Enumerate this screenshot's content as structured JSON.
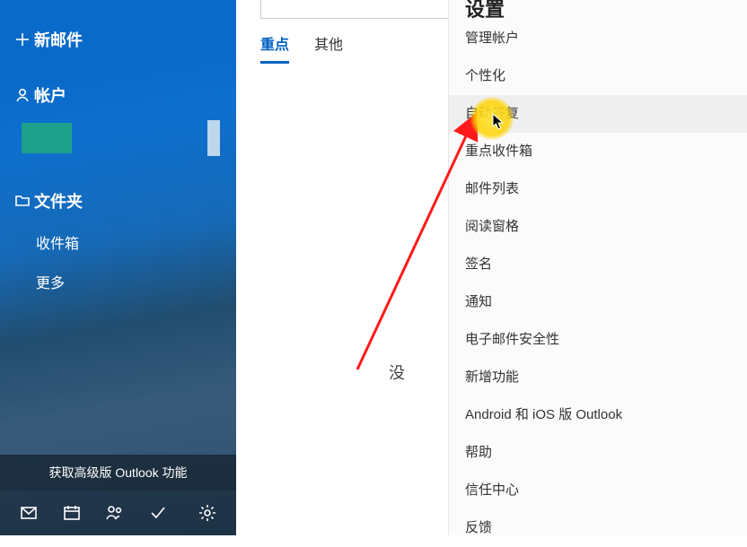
{
  "sidebar": {
    "new_mail": "新邮件",
    "accounts_header": "帐户",
    "folders_header": "文件夹",
    "folders": {
      "inbox": "收件箱",
      "more": "更多"
    },
    "upgrade": "获取高级版 Outlook 功能"
  },
  "tabs": {
    "focused": "重点",
    "other": "其他"
  },
  "main": {
    "empty": "没"
  },
  "settings": {
    "title": "设置",
    "items": {
      "manage_accounts": "管理帐户",
      "personalization": "个性化",
      "auto_reply": "自动答复",
      "focused_inbox": "重点收件箱",
      "mail_list": "邮件列表",
      "reading_pane": "阅读窗格",
      "signature": "签名",
      "notifications": "通知",
      "email_security": "电子邮件安全性",
      "whats_new": "新增功能",
      "mobile_outlook": "Android 和 iOS 版 Outlook",
      "help": "帮助",
      "trust_center": "信任中心",
      "feedback": "反馈"
    }
  }
}
